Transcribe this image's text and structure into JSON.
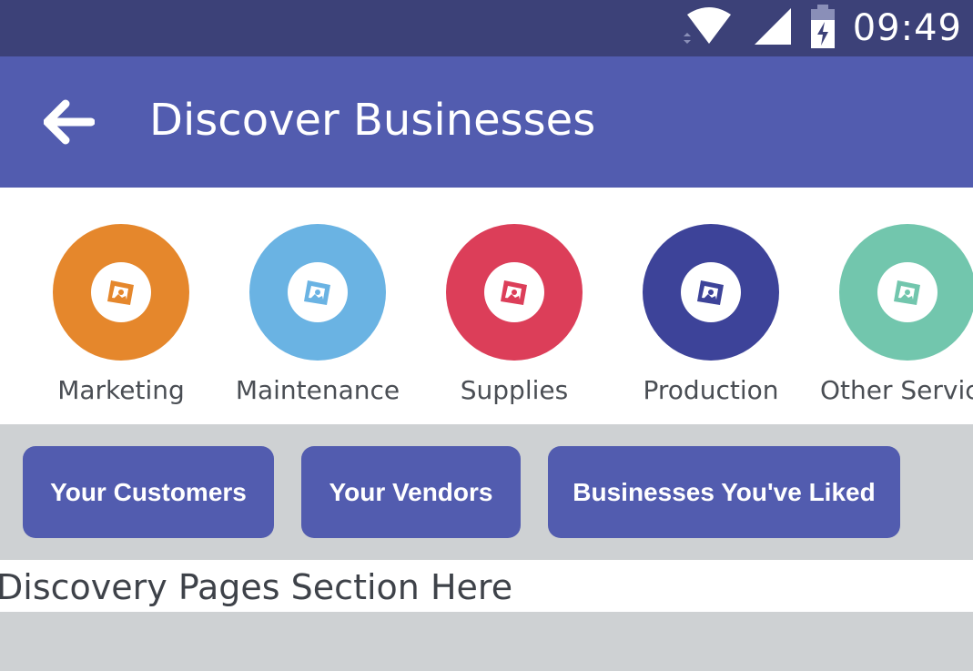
{
  "status_bar": {
    "time": "09:49",
    "icons": [
      "wifi-icon",
      "cell-signal-icon",
      "battery-charging-icon"
    ]
  },
  "app_bar": {
    "title": "Discover Businesses",
    "back_icon": "arrow-left-icon"
  },
  "categories": [
    {
      "label": "Marketing",
      "color": "#e5872c",
      "icon": "image-icon"
    },
    {
      "label": "Maintenance",
      "color": "#6ab3e3",
      "icon": "image-icon"
    },
    {
      "label": "Supplies",
      "color": "#dc3e59",
      "icon": "image-icon"
    },
    {
      "label": "Production",
      "color": "#3d4399",
      "icon": "image-icon"
    },
    {
      "label": "Other Services",
      "color": "#72c6ad",
      "icon": "image-icon"
    }
  ],
  "filters": [
    {
      "label": "Your Customers"
    },
    {
      "label": "Your Vendors"
    },
    {
      "label": "Businesses You've Liked"
    }
  ],
  "discovery": {
    "text": "Discovery Pages Section Here"
  },
  "colors": {
    "status_bar": "#3c4178",
    "primary": "#525caf",
    "background": "#ced1d3"
  }
}
